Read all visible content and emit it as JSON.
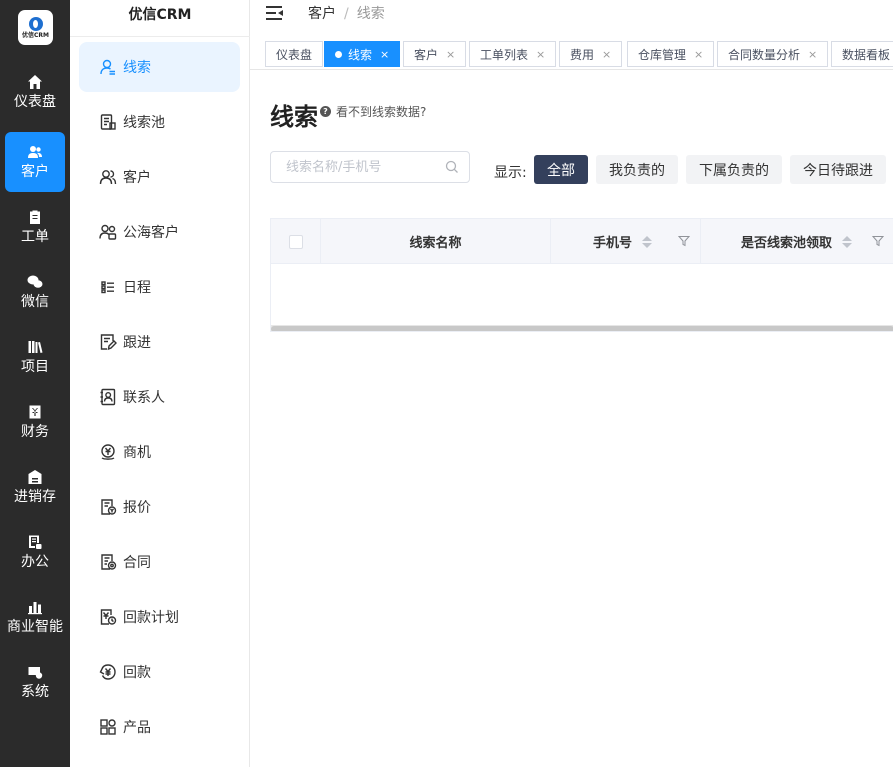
{
  "app": {
    "logo_text": "优信CRM",
    "sidebar_title": "优信CRM"
  },
  "colors": {
    "rail_bg": "#2b2b2b",
    "accent": "#1890ff",
    "active_filter": "#34405c"
  },
  "rail": {
    "items": [
      {
        "label": "仪表盘",
        "icon": "home-icon"
      },
      {
        "label": "客户",
        "icon": "users-icon",
        "active": true
      },
      {
        "label": "工单",
        "icon": "clipboard-icon"
      },
      {
        "label": "微信",
        "icon": "wechat-icon"
      },
      {
        "label": "项目",
        "icon": "books-icon"
      },
      {
        "label": "财务",
        "icon": "yen-icon"
      },
      {
        "label": "进销存",
        "icon": "warehouse-icon"
      },
      {
        "label": "办公",
        "icon": "office-icon"
      },
      {
        "label": "商业智能",
        "icon": "bar-chart-icon"
      },
      {
        "label": "系统",
        "icon": "settings-icon"
      }
    ]
  },
  "sidebar": {
    "items": [
      {
        "label": "线索",
        "icon": "lead-user-icon",
        "active": true
      },
      {
        "label": "线索池",
        "icon": "lead-pool-icon"
      },
      {
        "label": "客户",
        "icon": "customers-icon"
      },
      {
        "label": "公海客户",
        "icon": "public-customers-icon"
      },
      {
        "label": "日程",
        "icon": "schedule-icon"
      },
      {
        "label": "跟进",
        "icon": "follow-up-icon"
      },
      {
        "label": "联系人",
        "icon": "contacts-icon"
      },
      {
        "label": "商机",
        "icon": "opportunity-icon"
      },
      {
        "label": "报价",
        "icon": "quote-icon"
      },
      {
        "label": "合同",
        "icon": "contract-icon"
      },
      {
        "label": "回款计划",
        "icon": "payment-plan-icon"
      },
      {
        "label": "回款",
        "icon": "payment-icon"
      },
      {
        "label": "产品",
        "icon": "product-icon"
      }
    ]
  },
  "breadcrumb": {
    "parent": "客户",
    "separator": "/",
    "current": "线索"
  },
  "tabs": [
    {
      "label": "仪表盘",
      "closable": false
    },
    {
      "label": "线索",
      "closable": true,
      "active": true
    },
    {
      "label": "客户",
      "closable": true
    },
    {
      "label": "工单列表",
      "closable": true
    },
    {
      "label": "费用",
      "closable": true
    },
    {
      "label": "仓库管理",
      "closable": true
    },
    {
      "label": "合同数量分析",
      "closable": true
    },
    {
      "label": "数据看板",
      "closable": true
    }
  ],
  "tab_close_glyph": "×",
  "page": {
    "title": "线索",
    "help_text": "看不到线索数据?",
    "help_glyph": "?"
  },
  "search": {
    "placeholder": "线索名称/手机号",
    "value": ""
  },
  "filters": {
    "label": "显示:",
    "options": [
      "全部",
      "我负责的",
      "下属负责的",
      "今日待跟进"
    ],
    "selected": "全部"
  },
  "table": {
    "columns": [
      {
        "label": "线索名称",
        "sortable": false,
        "filterable": false
      },
      {
        "label": "手机号",
        "sortable": true,
        "filterable": true
      },
      {
        "label": "是否线索池领取",
        "sortable": true,
        "filterable": true
      }
    ],
    "rows": []
  }
}
